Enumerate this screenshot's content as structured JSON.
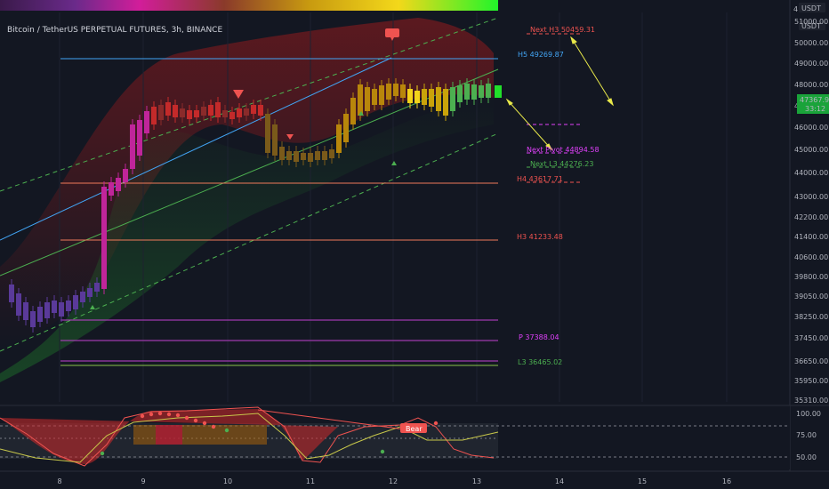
{
  "header": {
    "symbol_title": "Bitcoin / TetherUS PERPETUAL FUTURES, 3h, BINANCE",
    "currency": "USDT"
  },
  "price_axis": {
    "ticks": [
      "51000.00",
      "50000.00",
      "49000.00",
      "48000.00",
      "47000.00",
      "46000.00",
      "45000.00",
      "44000.00",
      "43000.00",
      "42200.00",
      "41400.00",
      "40600.00",
      "39800.00",
      "39050.00",
      "38250.00",
      "37450.00",
      "36650.00",
      "35950.00",
      "35310.00"
    ],
    "last_price": "47367.90",
    "countdown": "33:12",
    "top_label": "4"
  },
  "levels": [
    {
      "text": "Next H3 50459.31",
      "color": "#ef5350"
    },
    {
      "text": "H5 49269.87",
      "color": "#2196f3"
    },
    {
      "text": "Next Pivot 44894.58",
      "color": "#e040fb"
    },
    {
      "text": "Next L3 44276.23",
      "color": "#4caf50"
    },
    {
      "text": "H4 43617.71",
      "color": "#ef5350"
    },
    {
      "text": "H3 41233.48",
      "color": "#ef5350"
    },
    {
      "text": "P 37388.04",
      "color": "#e040fb"
    },
    {
      "text": "L3 36465.02",
      "color": "#4caf50"
    }
  ],
  "oscillator": {
    "ticks": [
      "100.00",
      "75.00",
      "50.00"
    ],
    "signal_label": "Bear"
  },
  "time_axis": {
    "ticks": [
      "8",
      "9",
      "10",
      "11",
      "12",
      "13",
      "14",
      "15",
      "16"
    ]
  },
  "colors": {
    "background": "#131722",
    "bull": "#26a69a",
    "bear": "#ef5350",
    "accent_magenta": "#e040fb",
    "arrow": "#e9e94a"
  }
}
